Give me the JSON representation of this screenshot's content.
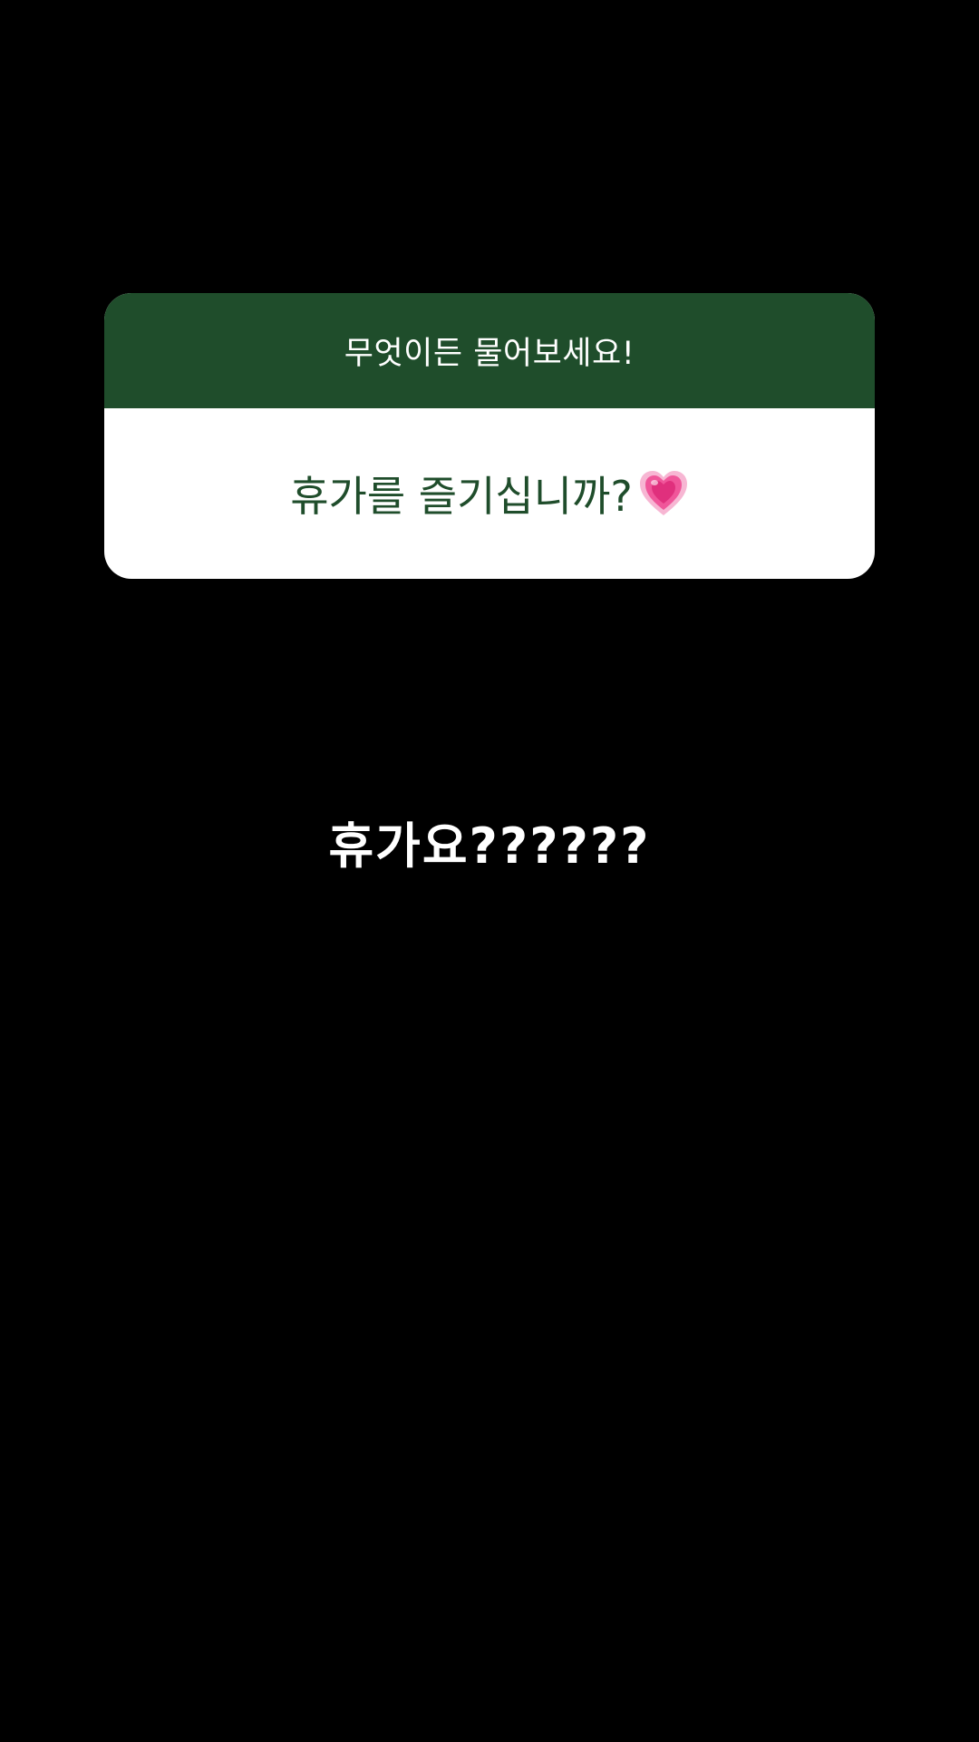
{
  "question_sticker": {
    "header_text": "무엇이든 물어보세요!",
    "question_text": "휴가를 즐기십니까?",
    "emoji_icon": "growing-heart-icon",
    "header_color": "#1f4d2b",
    "question_color": "#1f4d2b",
    "emoji_color": "#f0569a"
  },
  "answer": {
    "text": "휴가요??????"
  },
  "background_color": "#000000"
}
